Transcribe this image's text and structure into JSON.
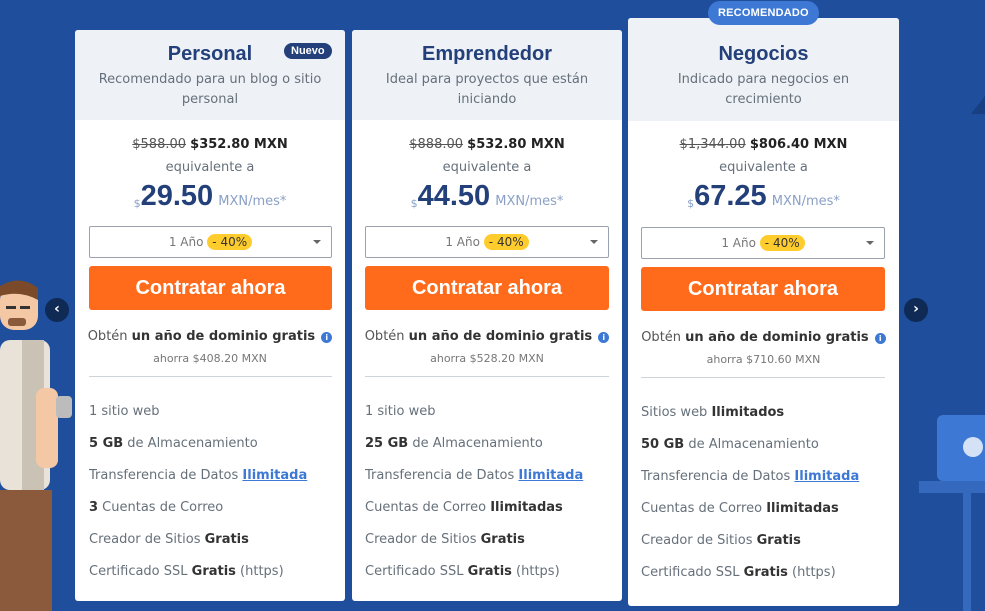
{
  "carousel": {
    "prev_icon": "chevron-left-icon",
    "next_icon": "chevron-right-icon"
  },
  "plans": [
    {
      "name": "Personal",
      "badge": "Nuevo",
      "description": "Recomendado para un blog o sitio personal",
      "price_old": "$588.00",
      "price_new": "$352.80 MXN",
      "equivalent": "equivalente a",
      "currency_symbol": "$",
      "monthly_amount": "29.50",
      "monthly_unit": "MXN/mes*",
      "period": "1 Año",
      "discount": "- 40%",
      "cta": "Contratar ahora",
      "domain_prefix": "Obtén",
      "domain_bold": "un año de dominio gratis",
      "savings": "ahorra $408.20 MXN",
      "features": [
        {
          "pre": "1 sitio web",
          "bold": "",
          "post": "",
          "link": ""
        },
        {
          "pre": "",
          "bold": "5 GB",
          "post": " de Almacenamiento",
          "link": ""
        },
        {
          "pre": "Transferencia de Datos ",
          "bold": "",
          "post": "",
          "link": "Ilimitada"
        },
        {
          "pre": "",
          "bold": "3",
          "post": " Cuentas de Correo",
          "link": ""
        },
        {
          "pre": "Creador de Sitios ",
          "bold": "Gratis",
          "post": "",
          "link": ""
        },
        {
          "pre": "Certificado SSL ",
          "bold": "Gratis",
          "post": " (https)",
          "link": ""
        }
      ]
    },
    {
      "name": "Emprendedor",
      "badge": "",
      "description": "Ideal para proyectos que están iniciando",
      "price_old": "$888.00",
      "price_new": "$532.80 MXN",
      "equivalent": "equivalente a",
      "currency_symbol": "$",
      "monthly_amount": "44.50",
      "monthly_unit": "MXN/mes*",
      "period": "1 Año",
      "discount": "- 40%",
      "cta": "Contratar ahora",
      "domain_prefix": "Obtén",
      "domain_bold": "un año de dominio gratis",
      "savings": "ahorra $528.20 MXN",
      "features": [
        {
          "pre": "1 sitio web",
          "bold": "",
          "post": "",
          "link": ""
        },
        {
          "pre": "",
          "bold": "25 GB",
          "post": " de Almacenamiento",
          "link": ""
        },
        {
          "pre": "Transferencia de Datos ",
          "bold": "",
          "post": "",
          "link": "Ilimitada"
        },
        {
          "pre": "Cuentas de Correo ",
          "bold": "Ilimitadas",
          "post": "",
          "link": ""
        },
        {
          "pre": "Creador de Sitios ",
          "bold": "Gratis",
          "post": "",
          "link": ""
        },
        {
          "pre": "Certificado SSL ",
          "bold": "Gratis",
          "post": " (https)",
          "link": ""
        }
      ]
    },
    {
      "name": "Negocios",
      "badge": "RECOMENDADO",
      "description": "Indicado para negocios en crecimiento",
      "price_old": "$1,344.00",
      "price_new": "$806.40 MXN",
      "equivalent": "equivalente a",
      "currency_symbol": "$",
      "monthly_amount": "67.25",
      "monthly_unit": "MXN/mes*",
      "period": "1 Año",
      "discount": "- 40%",
      "cta": "Contratar ahora",
      "domain_prefix": "Obtén",
      "domain_bold": "un año de dominio gratis",
      "savings": "ahorra $710.60 MXN",
      "features": [
        {
          "pre": "Sitios web ",
          "bold": "Ilimitados",
          "post": "",
          "link": ""
        },
        {
          "pre": "",
          "bold": "50 GB",
          "post": " de Almacenamiento",
          "link": ""
        },
        {
          "pre": "Transferencia de Datos ",
          "bold": "",
          "post": "",
          "link": "Ilimitada"
        },
        {
          "pre": "Cuentas de Correo ",
          "bold": "Ilimitadas",
          "post": "",
          "link": ""
        },
        {
          "pre": "Creador de Sitios ",
          "bold": "Gratis",
          "post": "",
          "link": ""
        },
        {
          "pre": "Certificado SSL ",
          "bold": "Gratis",
          "post": " (https)",
          "link": ""
        }
      ]
    }
  ],
  "colors": {
    "background": "#1f4e9c",
    "brand_navy": "#23407a",
    "cta_orange": "#ff6b1a",
    "discount_yellow": "#ffcc2e",
    "accent_blue": "#3d78d4"
  }
}
